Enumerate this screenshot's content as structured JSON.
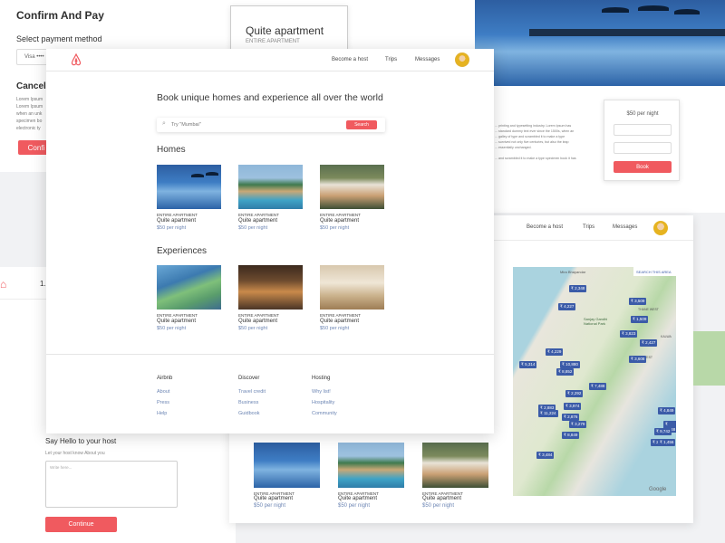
{
  "colors": {
    "accent": "#f05a5f",
    "blue_text": "#6d86b4",
    "pin": "#3b5ba8"
  },
  "confirm_page": {
    "title": "Confirm And Pay",
    "payment_label": "Select payment method",
    "payment_value": "Visa ••••",
    "cancel_heading": "Cancell",
    "cancel_text_lines": [
      "Lorem Ipsum",
      "Lorem Ipsum",
      "when an unk",
      "specimen bo",
      "electronic ty"
    ],
    "confirm_button": "Confi"
  },
  "listing_card": {
    "title": "Quite apartment",
    "subtitle": "ENTIRE APARTMENT"
  },
  "booking": {
    "price": "$50 per night",
    "book_button": "Book",
    "description_lines": [
      "... printing and typesetting industry. Lorem Ipsum has",
      "... standard dummy text ever since the 1500s, when an",
      "... galley of type and scrambled it to make a type",
      "... survived not only five centuries, but also the leap",
      "... essentially unchanged.",
      "",
      "... and scrambled it to make a type specimen book it has"
    ]
  },
  "main": {
    "nav": {
      "become_host": "Become a host",
      "trips": "Trips",
      "messages": "Messages"
    },
    "hero_title": "Book unique homes and experience all over the world",
    "search": {
      "placeholder": "Try \"Mumbai\"",
      "button": "Search"
    },
    "homes_heading": "Homes",
    "experiences_heading": "Experiences",
    "homes": [
      {
        "type": "ENTIRE APARTMENT",
        "name": "Quite apartment",
        "price": "$50 per night"
      },
      {
        "type": "ENTIRE APARTMENT",
        "name": "Quite apartment",
        "price": "$50 per night"
      },
      {
        "type": "ENTIRE APARTMENT",
        "name": "Quite apartment",
        "price": "$50 per night"
      }
    ],
    "experiences": [
      {
        "type": "ENTIRE APARTMENT",
        "name": "Quite apartment",
        "price": "$50 per night"
      },
      {
        "type": "ENTIRE APARTMENT",
        "name": "Quite apartment",
        "price": "$50 per night"
      },
      {
        "type": "ENTIRE APARTMENT",
        "name": "Quite apartment",
        "price": "$50 per night"
      }
    ],
    "footer": {
      "airbnb": {
        "heading": "Airbnb",
        "links": [
          "About",
          "Press",
          "Help"
        ]
      },
      "discover": {
        "heading": "Discover",
        "links": [
          "Travel credit",
          "Business",
          "Guidbook"
        ]
      },
      "hosting": {
        "heading": "Hosting",
        "links": [
          "Why list!",
          "Hospitality",
          "Community"
        ]
      }
    }
  },
  "host_page": {
    "step": "1.",
    "say_hello": "Say Hello to your host",
    "let_know": "Let your host know About you",
    "textarea_placeholder": "Write here...",
    "continue_button": "Continue"
  },
  "map_page": {
    "nav": {
      "become_host": "Become a host",
      "trips": "Trips",
      "messages": "Messages"
    },
    "search_area": "SEARCH THIS AREA",
    "map_labels": [
      "Mira Bhayandar",
      "Sanjay Gandhi National Park",
      "THANE WEST",
      "KALWA",
      "MULUND WEST"
    ],
    "google": "Google",
    "prices": [
      "₹ 2,348",
      "₹ 3,509",
      "₹ 4,227",
      "₹ 1,509",
      "₹ 3,823",
      "₹ 2,427",
      "₹ 4,229",
      "₹ 3,608",
      "₹ 5,314",
      "₹ 10,880",
      "₹ 8,852",
      "₹ 7,488",
      "₹ 2,292",
      "₹ 2,883",
      "₹ 3,974",
      "₹ 11,224",
      "₹ 2,876",
      "₹ 3,279",
      "₹ 4,849",
      "₹ 8,849",
      "₹ 6,848",
      "₹ 9,742",
      "₹ 2,778",
      "₹ 1,456",
      "₹ 3,484"
    ],
    "listings": [
      {
        "type": "ENTIRE APARTMENT",
        "name": "Quite apartment",
        "price": "$50 per night"
      },
      {
        "type": "ENTIRE APARTMENT",
        "name": "Quite apartment",
        "price": "$50 per night"
      },
      {
        "type": "ENTIRE APARTMENT",
        "name": "Quite apartment",
        "price": "$50 per night"
      }
    ]
  }
}
